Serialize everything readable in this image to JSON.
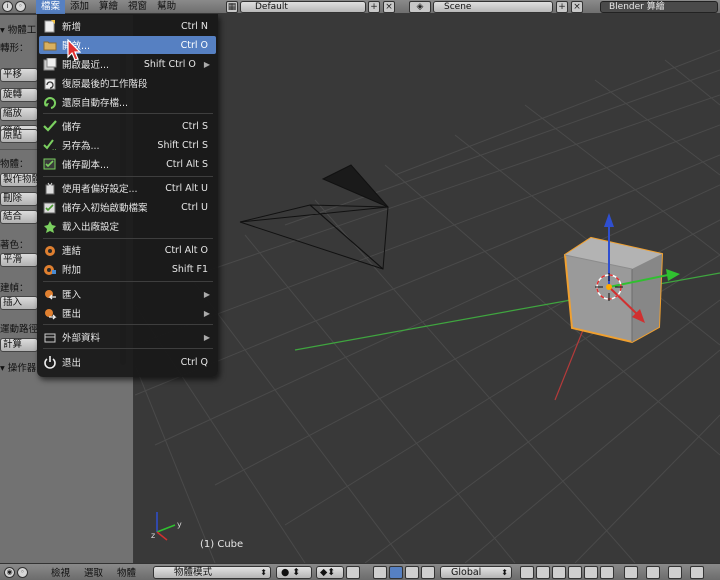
{
  "topbar": {
    "menus": [
      "檔案",
      "添加",
      "算繪",
      "視窗",
      "幫助"
    ],
    "active_menu": "檔案",
    "screen_layout": "Default",
    "scene": "Scene",
    "render_engine": "Blender 算繪"
  },
  "tool_panel": {
    "header": "物體工",
    "transform_label": "轉形：",
    "buttons": [
      "平移",
      "旋轉",
      "縮放"
    ],
    "mirror_btn": "鏡像",
    "origin_btn": "原點",
    "object_label": "物體：",
    "object_buttons": [
      "製作物體",
      "刪除",
      "結合"
    ],
    "shading_label": "著色：",
    "shading_btn": "平滑",
    "keyframe_label": "建幀：",
    "keyframe_btn": "插入",
    "motion_label": "運動路徑",
    "calc_btn": "計算",
    "operator_header": "操作器"
  },
  "file_menu": {
    "items": [
      {
        "label": "新增",
        "shortcut": "Ctrl N",
        "icon": "new-file-icon"
      },
      {
        "label": "開啟...",
        "shortcut": "Ctrl O",
        "icon": "folder-open-icon",
        "highlight": true
      },
      {
        "label": "開啟最近...",
        "shortcut": "Shift Ctrl O",
        "icon": "recent-files-icon",
        "submenu": true
      },
      {
        "label": "復原最後的工作階段",
        "shortcut": "",
        "icon": "recover-session-icon"
      },
      {
        "label": "還原自動存檔...",
        "shortcut": "",
        "icon": "recover-auto-icon"
      },
      {
        "label": "儲存",
        "shortcut": "Ctrl S",
        "icon": "save-check-icon"
      },
      {
        "label": "另存為...",
        "shortcut": "Shift Ctrl S",
        "icon": "save-as-icon"
      },
      {
        "label": "儲存副本...",
        "shortcut": "Ctrl Alt S",
        "icon": "save-copy-icon"
      },
      {
        "label": "使用者偏好設定...",
        "shortcut": "Ctrl Alt U",
        "icon": "preferences-icon"
      },
      {
        "label": "儲存入初始啟動檔案",
        "shortcut": "Ctrl U",
        "icon": "save-startup-icon"
      },
      {
        "label": "載入出廠設定",
        "shortcut": "",
        "icon": "factory-settings-icon"
      },
      {
        "label": "連結",
        "shortcut": "Ctrl Alt O",
        "icon": "link-blend-icon"
      },
      {
        "label": "附加",
        "shortcut": "Shift F1",
        "icon": "append-blend-icon"
      },
      {
        "label": "匯入",
        "shortcut": "",
        "icon": "import-icon",
        "submenu": true
      },
      {
        "label": "匯出",
        "shortcut": "",
        "icon": "export-icon",
        "submenu": true
      },
      {
        "label": "外部資料",
        "shortcut": "",
        "icon": "external-data-icon",
        "submenu": true
      },
      {
        "label": "退出",
        "shortcut": "Ctrl Q",
        "icon": "quit-icon"
      }
    ]
  },
  "viewport": {
    "object_label": "(1) Cube"
  },
  "bottombar": {
    "menus": [
      "檢視",
      "選取",
      "物體"
    ],
    "mode": "物體模式",
    "orientation": "Global"
  },
  "colors": {
    "highlight": "#5680c2",
    "selection_outline": "#f0a030",
    "axis_x": "#d03030",
    "axis_y": "#30c030",
    "axis_z": "#2f4fd0"
  }
}
